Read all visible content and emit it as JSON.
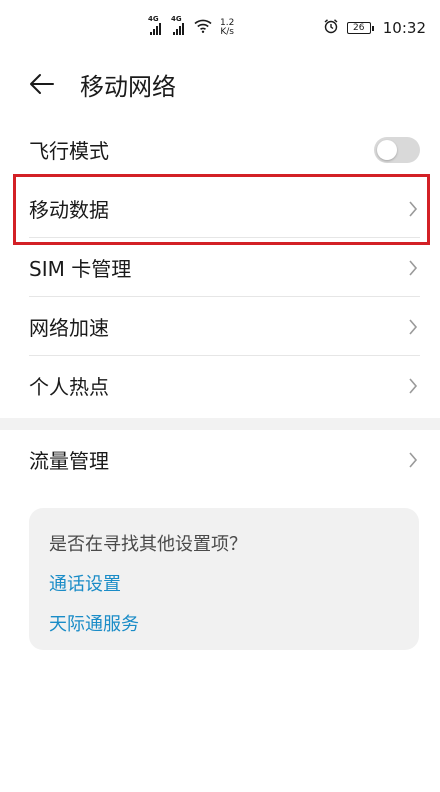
{
  "status_bar": {
    "sim1_label": "4G",
    "sim2_label": "4G",
    "speed_value": "1.2",
    "speed_unit": "K/s",
    "battery": "26",
    "time": "10:32",
    "icons": [
      "signal-icon",
      "signal-icon",
      "wifi-icon",
      "alarm-icon",
      "battery-icon"
    ]
  },
  "header": {
    "title": "移动网络"
  },
  "menu": {
    "items": [
      {
        "label": "飞行模式",
        "control": "toggle",
        "state": "off"
      },
      {
        "label": "移动数据",
        "control": "chevron"
      },
      {
        "label": "SIM 卡管理",
        "control": "chevron"
      },
      {
        "label": "网络加速",
        "control": "chevron"
      },
      {
        "label": "个人热点",
        "control": "chevron"
      }
    ]
  },
  "menu2": {
    "items": [
      {
        "label": "流量管理",
        "control": "chevron"
      }
    ]
  },
  "suggestions": {
    "question": "是否在寻找其他设置项？",
    "links": [
      "通话设置",
      "天际通服务"
    ]
  },
  "colors": {
    "highlight_border": "#d32026",
    "link": "#1a8cc7",
    "toggle_off": "#d9d9d9"
  }
}
